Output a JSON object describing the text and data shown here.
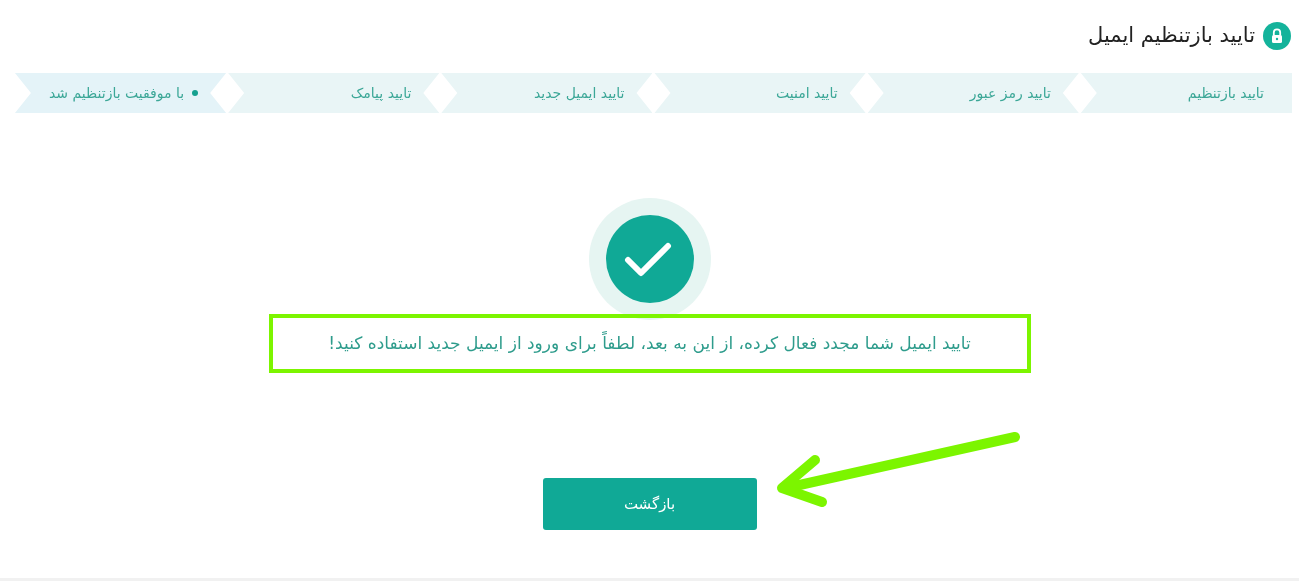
{
  "header": {
    "title": "تایید بازتنظیم ایمیل"
  },
  "steps": [
    {
      "label": "تایید بازتنظیم",
      "selected": false
    },
    {
      "label": "تایید رمز عبور",
      "selected": false
    },
    {
      "label": "تایید امنیت",
      "selected": false
    },
    {
      "label": "تایید ایمیل جدید",
      "selected": false
    },
    {
      "label": "تایید پیامک",
      "selected": false
    },
    {
      "label": "با موفقیت بازتنظیم شد",
      "selected": true
    }
  ],
  "success": {
    "message": "تایید ایمیل شما مجدد فعال کرده، از این به بعد، لطفاً برای ورود از ایمیل جدید استفاده کنید!"
  },
  "back_button": {
    "label": "بازگشت"
  },
  "annotations": {
    "highlight": true,
    "arrow": true
  }
}
